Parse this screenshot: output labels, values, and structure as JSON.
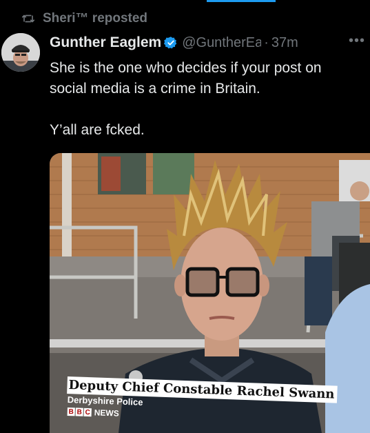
{
  "repost": {
    "text": "Sheri™ reposted",
    "icon": "repost-icon"
  },
  "author": {
    "name": "Gunther Eaglem",
    "handle": "@GuntherEagle",
    "separator": "·",
    "time": "37m",
    "verified": true,
    "more": "•••"
  },
  "post": {
    "lines": [
      "She is the one who decides if your post on social media is a crime in Britain.",
      "Y’all are fcked."
    ]
  },
  "media": {
    "caption_title": "Deputy Chief Constable Rachel Swann",
    "caption_subtitle": "Derbyshire Police",
    "brand_letters": [
      "B",
      "B",
      "C"
    ],
    "brand_word": "NEWS"
  },
  "colors": {
    "background": "#000000",
    "text": "#e7e9ea",
    "muted": "#71767b",
    "verified": "#1d9bf0"
  }
}
